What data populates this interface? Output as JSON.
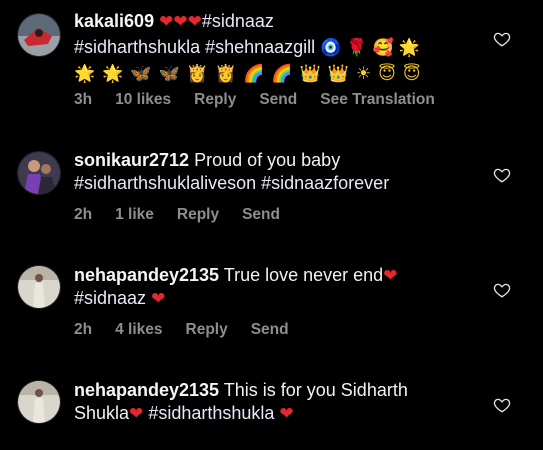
{
  "comments": [
    {
      "username": "kakali609",
      "line1_tag": "#sidnaaz",
      "line2": "#sidharthshukla #shehnaazgill",
      "emoji_line1": [
        "❤",
        "❤",
        "❤"
      ],
      "emoji_line2": [
        "🧿",
        "🌹",
        "🥰",
        "🌟"
      ],
      "emoji_line3": [
        "🌟",
        "🌟",
        "🦋",
        "🦋",
        "👸",
        "👸",
        "🌈",
        "🌈",
        "👑",
        "👑",
        "☀",
        "😇",
        "😇"
      ],
      "time": "3h",
      "likes": "10 likes",
      "reply": "Reply",
      "send": "Send",
      "translate": "See Translation"
    },
    {
      "username": "sonikaur2712",
      "line1_text": "Proud of you baby",
      "line2": "#sidharthshuklaliveson #sidnaazforever",
      "time": "2h",
      "likes": "1 like",
      "reply": "Reply",
      "send": "Send"
    },
    {
      "username": "nehapandey2135",
      "line1_text": "True love never end",
      "line1_heart": "❤",
      "line2_tag": "#sidnaaz",
      "line2_heart": "❤",
      "time": "2h",
      "likes": "4 likes",
      "reply": "Reply",
      "send": "Send"
    },
    {
      "username": "nehapandey2135",
      "line1_text": "This is for you Sidharth",
      "line2_text": "Shukla",
      "line2_heart1": "❤",
      "line2_tag": "#sidharthshukla",
      "line2_heart2": "❤"
    }
  ],
  "colors": {
    "background": "#000000",
    "meta_gray": "#8e8e8e",
    "heart_red": "#e8262e"
  },
  "icons": {
    "like": "heart-outline-icon"
  }
}
